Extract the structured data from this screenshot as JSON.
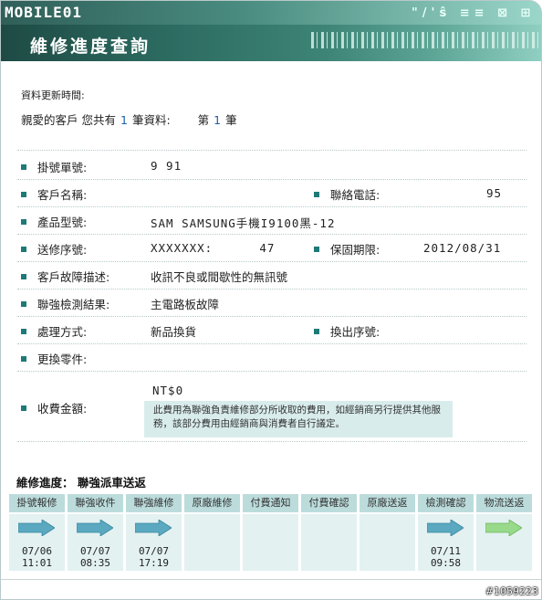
{
  "header": {
    "logo": "MOBILE01",
    "title": "維修進度查詢",
    "deco": "\"/'ŝ ≡≡ ⊠ ⊞"
  },
  "meta": {
    "updated_label": "資料更新時間:",
    "count_prefix": "親愛的客戶 您共有",
    "count": "1",
    "count_suffix": "筆資料:",
    "page_prefix": "第",
    "page": "1",
    "page_suffix": "筆"
  },
  "fields": {
    "order_no_label": "掛號單號:",
    "order_no": "9    91",
    "customer_label": "客戶名稱:",
    "customer": "",
    "phone_label": "聯絡電話:",
    "phone": "95",
    "model_label": "產品型號:",
    "model": "SAM SAMSUNG手機I9100黑-12",
    "serial_label": "送修序號:",
    "serial": "XXXXXXX:      47",
    "warranty_label": "保固期限:",
    "warranty": "2012/08/31",
    "fault_label": "客戶故障描述:",
    "fault": "收訊不良或間歇性的無訊號",
    "check_label": "聯強檢測結果:",
    "check": "主電路板故障",
    "handle_label": "處理方式:",
    "handle": "新品換貨",
    "swap_label": "換出序號:",
    "swap": "",
    "parts_label": "更換零件:",
    "parts": "",
    "fee_label": "收費金額:",
    "fee": "NT$0",
    "fee_note": "此費用為聯強負責維修部分所收取的費用，如經銷商另行提供其他服務，該部分費用由經銷商與消費者自行議定。"
  },
  "progress": {
    "title": "維修進度：  聯強派車送返",
    "steps": [
      {
        "name": "掛號報修",
        "date": "07/06",
        "time": "11:01",
        "done": true
      },
      {
        "name": "聯強收件",
        "date": "07/07",
        "time": "08:35",
        "done": true
      },
      {
        "name": "聯強維修",
        "date": "07/07",
        "time": "17:19",
        "done": true
      },
      {
        "name": "原廠維修",
        "date": "",
        "time": "",
        "done": false
      },
      {
        "name": "付費通知",
        "date": "",
        "time": "",
        "done": false
      },
      {
        "name": "付費確認",
        "date": "",
        "time": "",
        "done": false
      },
      {
        "name": "原廠送返",
        "date": "",
        "time": "",
        "done": false
      },
      {
        "name": "檢測確認",
        "date": "07/11",
        "time": "09:58",
        "done": true
      },
      {
        "name": "物流送返",
        "date": "",
        "time": "",
        "done": true,
        "current": true
      }
    ]
  },
  "watermark": "#1059223",
  "colors": {
    "teal": "#1e7a78",
    "arrow": "#5aa9c0",
    "arrow_current": "#98d98a",
    "step_header": "#bcdcdc"
  }
}
